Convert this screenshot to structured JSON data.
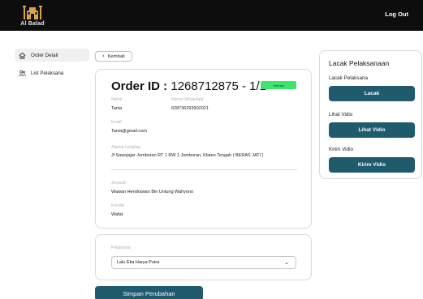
{
  "header": {
    "logo_text": "Al Balad",
    "logout_label": "Log Out",
    "bg_color": "#0d0d0d"
  },
  "sidebar": {
    "items": [
      {
        "label": "Order Detail",
        "icon": "home-icon",
        "active": true
      },
      {
        "label": "List Pelaksana",
        "icon": "users-icon",
        "active": false
      }
    ]
  },
  "back_button": {
    "label": "Kembali",
    "icon": "chevron-left-icon"
  },
  "order": {
    "title_prefix": "Order ID :",
    "id_value": "1268712875 - 1/1",
    "status": "Selesai",
    "status_color": "#3de56d",
    "fields": {
      "nama_label": "Nama",
      "nama_value": "Tania",
      "wa_label": "Nomor WhatsApp",
      "wa_value": "628736293902021",
      "email_label": "Email",
      "email_value": "Tania@gmail.com",
      "alamat_label": "Alamat Lengkap",
      "alamat_value": "Jl Sawojajar Jomboran RT 1 RW 1 Jomboran, Klaten Tengah ( BERAS JATI )",
      "jenazah_label": "Jenazah",
      "jenazah_value": "Wawan Hendrawan Bin Untung Wahyono",
      "kondisi_label": "Kondisi",
      "kondisi_value": "Wafat"
    }
  },
  "pelaksana": {
    "label": "Pelaksana",
    "selected": "Lalu Eka Harya Putra",
    "icon": "chevron-down-icon"
  },
  "save_button": {
    "label": "Simpan Perubahan",
    "color": "#1f5b6d"
  },
  "lacak_panel": {
    "title": "Lacak Pelaksanaan",
    "lacak_label": "Lacak Pelaksana",
    "lacak_button": "Lacak",
    "lihat_label": "Lihat Vidio",
    "lihat_button": "Lihat Vidio",
    "kirim_label": "Kirim Vidio",
    "kirim_button": "Kirim Vidio",
    "button_color": "#1f5b6d"
  }
}
